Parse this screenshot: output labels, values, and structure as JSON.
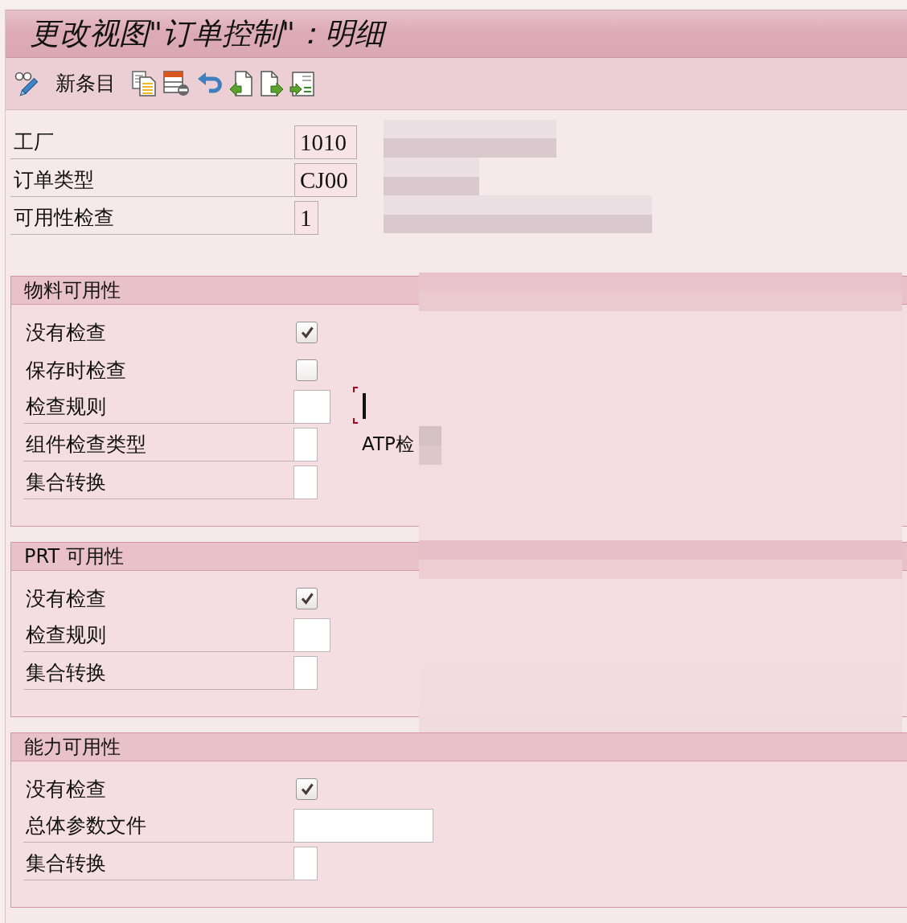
{
  "window": {
    "title": "更改视图\"订单控制\"：明细"
  },
  "toolbar": {
    "buttons": [
      {
        "label": "新条目"
      }
    ]
  },
  "header_fields": [
    {
      "label": "工厂",
      "value": "1010"
    },
    {
      "label": "订单类型",
      "value": "CJ00"
    },
    {
      "label": "可用性检查",
      "value": "1"
    }
  ],
  "sections": [
    {
      "title": "物料可用性",
      "rows": [
        {
          "kind": "checkbox",
          "label": "没有检查",
          "checked": true
        },
        {
          "kind": "checkbox",
          "label": "保存时检查",
          "checked": false
        },
        {
          "kind": "field",
          "label": "检查规则",
          "cursor": true
        },
        {
          "kind": "field",
          "label": "组件检查类型",
          "cursor": false,
          "description": "ATP检"
        },
        {
          "kind": "field",
          "label": "集合转换",
          "cursor": false
        }
      ]
    },
    {
      "title": "PRT 可用性",
      "rows": [
        {
          "kind": "checkbox",
          "label": "没有检查",
          "checked": true
        },
        {
          "kind": "field",
          "label": "检查规则",
          "cursor": false
        },
        {
          "kind": "field",
          "label": "集合转换",
          "cursor": false
        }
      ]
    },
    {
      "title": "能力可用性",
      "rows": [
        {
          "kind": "checkbox",
          "label": "没有检查",
          "checked": true
        },
        {
          "kind": "field",
          "label": "总体参数文件",
          "cursor": false
        },
        {
          "kind": "field",
          "label": "集合转换",
          "cursor": false
        }
      ]
    }
  ]
}
